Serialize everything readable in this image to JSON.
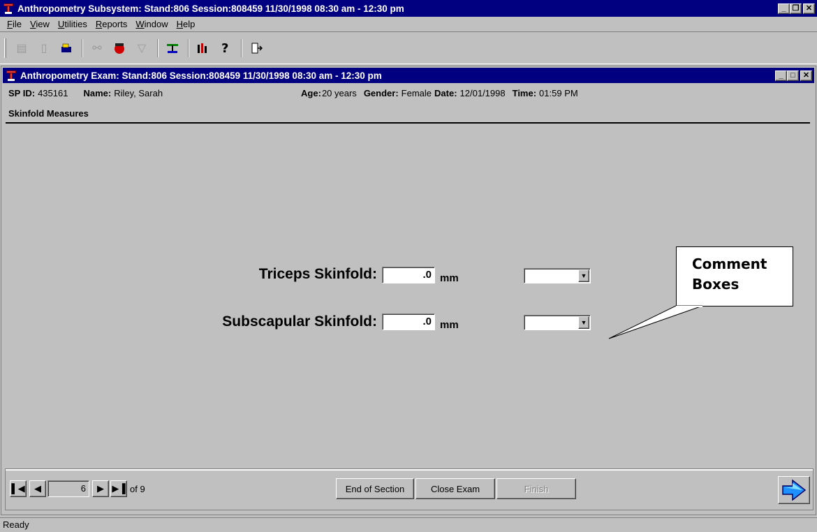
{
  "app": {
    "title": "Anthropometry Subsystem: Stand:806 Session:808459 11/30/1998 08:30 am - 12:30 pm",
    "menu": [
      "File",
      "View",
      "Utilities",
      "Reports",
      "Window",
      "Help"
    ],
    "menu_mnemonics": [
      "F",
      "V",
      "U",
      "R",
      "W",
      "H"
    ]
  },
  "toolbar": {
    "icons": [
      "new-icon",
      "clipboard-icon",
      "open-icon",
      "binoculars-icon",
      "stop-hand-icon",
      "inbox-icon",
      "balance-scale-icon",
      "stats-icon",
      "help-icon",
      "exit-icon"
    ]
  },
  "exam": {
    "title": "Anthropometry Exam: Stand:806 Session:808459 11/30/1998 08:30 am - 12:30 pm",
    "sp_id_label": "SP ID:",
    "sp_id": "435161",
    "name_label": "Name:",
    "name": "Riley, Sarah",
    "age_label": "Age:",
    "age": "20 years",
    "gender_label": "Gender:",
    "gender": "Female",
    "date_label": "Date:",
    "date": "12/01/1998",
    "time_label": "Time:",
    "time": "01:59 PM",
    "section": "Skinfold Measures"
  },
  "fields": {
    "triceps_label": "Triceps Skinfold:",
    "triceps_value": ".0",
    "triceps_unit": "mm",
    "subscap_label": "Subscapular Skinfold:",
    "subscap_value": ".0",
    "subscap_unit": "mm"
  },
  "callout": {
    "line1": "Comment",
    "line2": "Boxes"
  },
  "nav": {
    "page": "6",
    "of_label": "of 9",
    "end_section": "End of Section",
    "close_exam": "Close Exam",
    "finish": "Finish"
  },
  "status": "Ready"
}
